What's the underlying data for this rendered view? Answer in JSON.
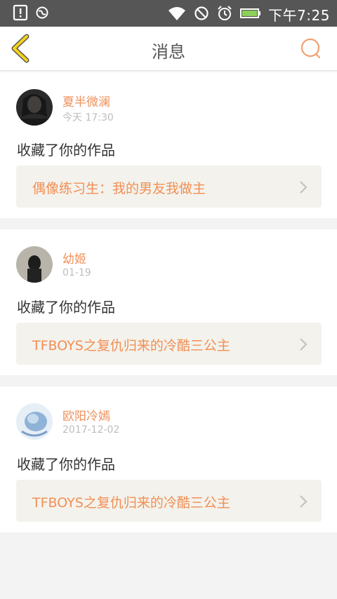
{
  "status_bar": {
    "time": "下午7:25",
    "icons": [
      "alert-icon",
      "globe-icon",
      "wifi-icon",
      "do-not-disturb-icon",
      "alarm-icon",
      "battery-icon"
    ]
  },
  "header": {
    "title": "消息",
    "back_icon": "chevron-left-icon",
    "search_icon": "search-icon",
    "accent_color": "#f5d21a",
    "search_color": "#f0a070"
  },
  "messages": [
    {
      "user_name": "夏半微澜",
      "time": "今天 17:30",
      "action": "收藏了你的作品",
      "work_title": "偶像练习生：我的男友我做主"
    },
    {
      "user_name": "幼姬",
      "time": "01-19",
      "action": "收藏了你的作品",
      "work_title": "TFBOYS之复仇归来的冷酷三公主"
    },
    {
      "user_name": "欧阳冷嫣",
      "time": "2017-12-02",
      "action": "收藏了你的作品",
      "work_title": "TFBOYS之复仇归来的冷酷三公主"
    }
  ],
  "colors": {
    "name": "#f0905a",
    "work_title": "#f28f55",
    "work_bg": "#f3f2ec",
    "page_bg": "#f3f3f3"
  }
}
